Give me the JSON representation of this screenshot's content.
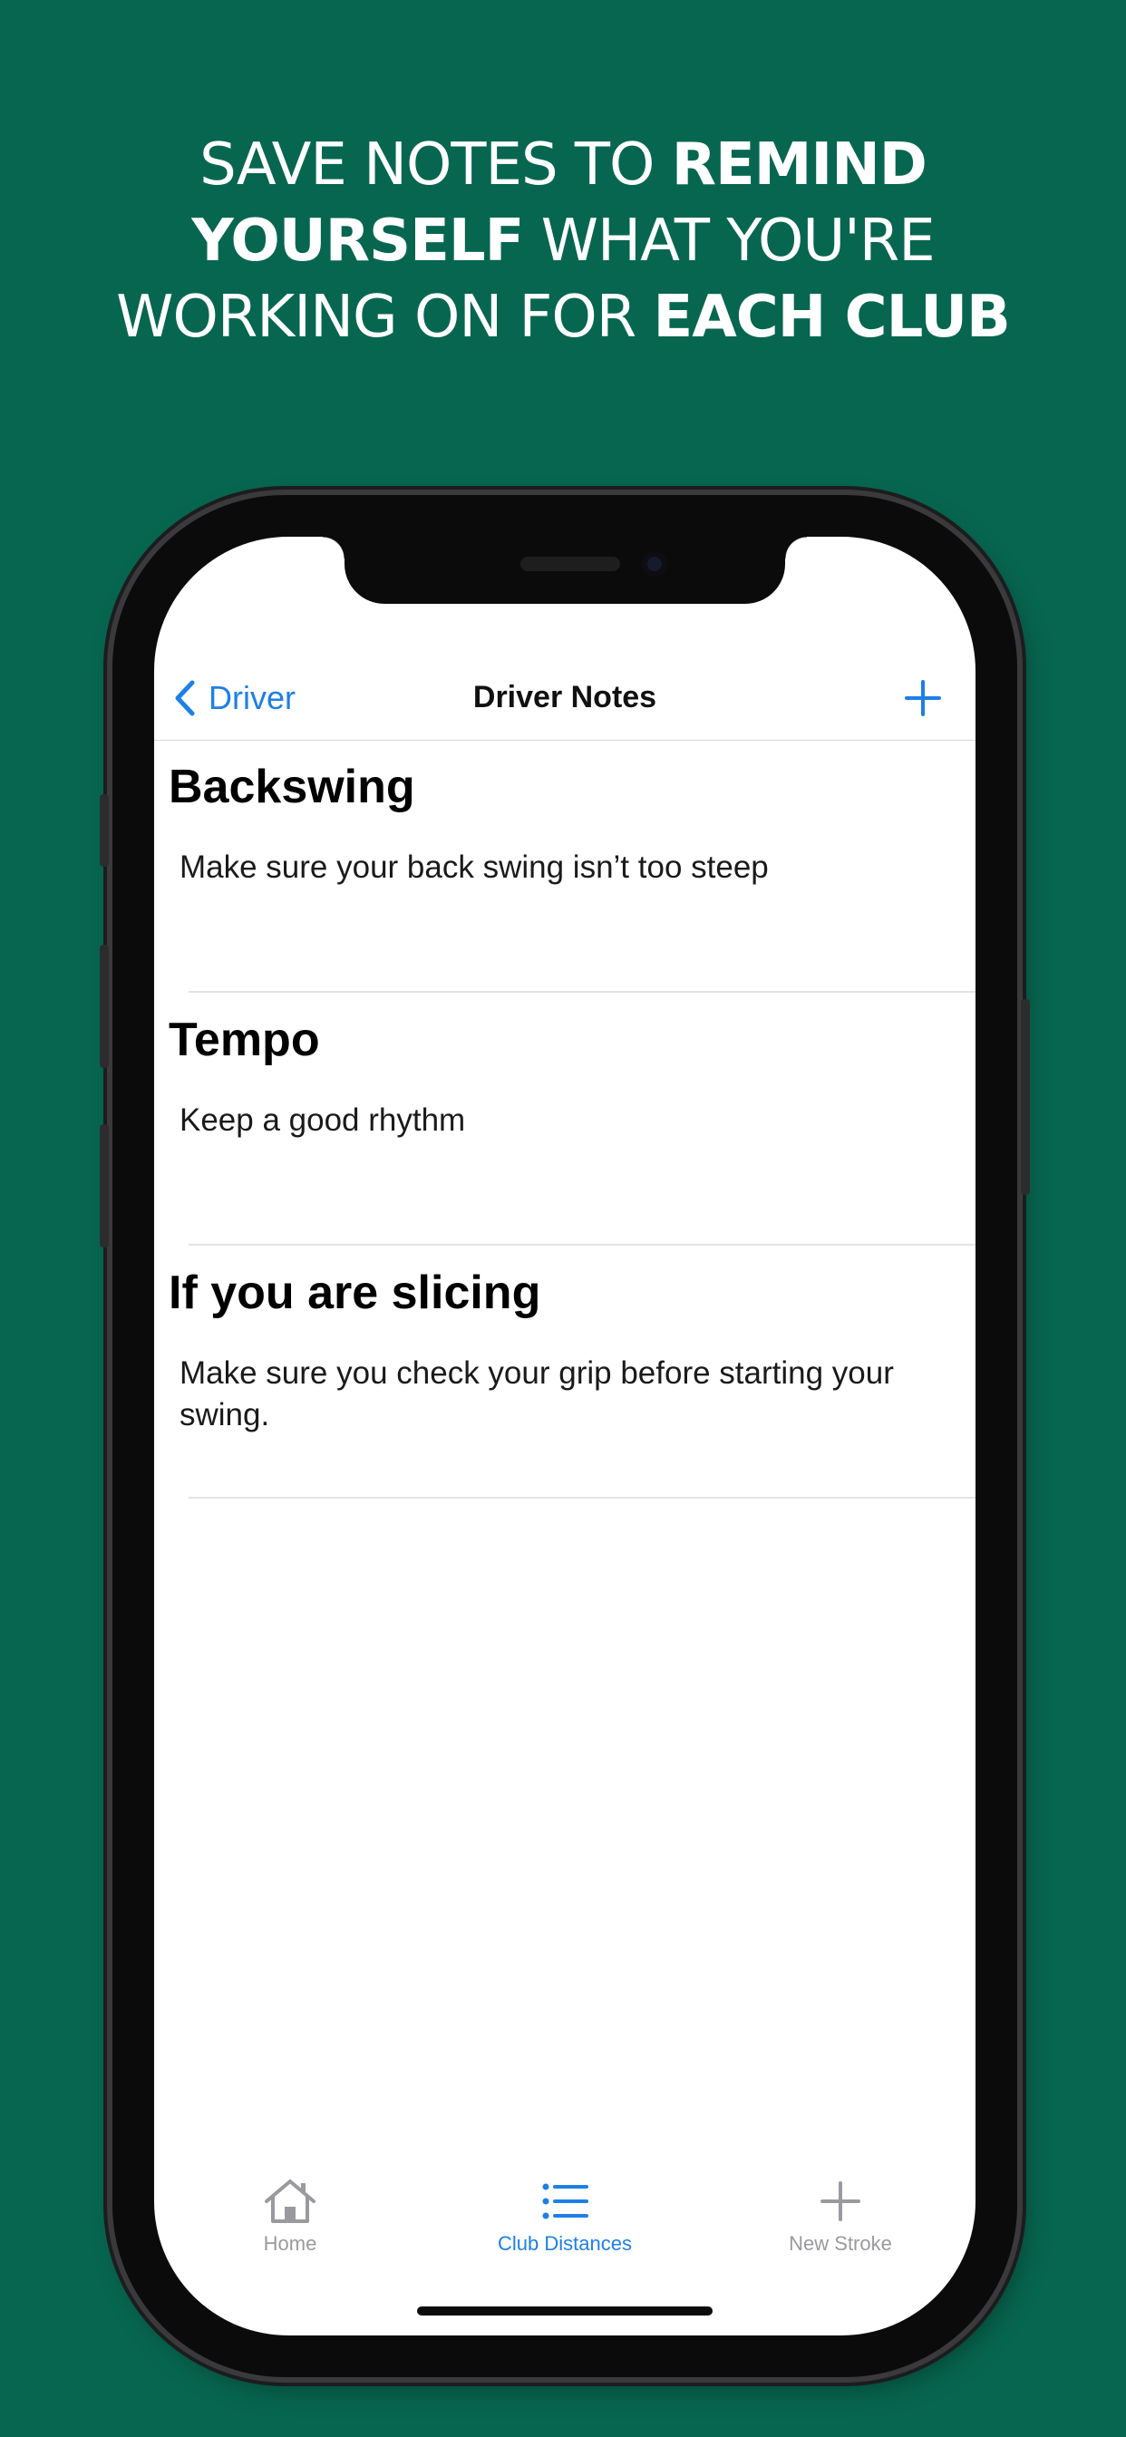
{
  "headline": {
    "line1_regular": "SAVE NOTES TO ",
    "line1_bold": "REMIND",
    "line2_bold": "YOURSELF",
    "line2_regular": " WHAT YOU'RE",
    "line3_regular": "WORKING ON FOR ",
    "line3_bold": "EACH CLUB"
  },
  "navbar": {
    "back_label": "Driver",
    "title": "Driver Notes",
    "add_icon": "plus-icon"
  },
  "notes": [
    {
      "title": "Backswing",
      "body": "Make sure your back swing isn’t too steep"
    },
    {
      "title": "Tempo",
      "body": "Keep a good rhythm"
    },
    {
      "title": "If you are slicing",
      "body": "Make sure you check your grip before starting your swing."
    }
  ],
  "tabbar": {
    "tabs": [
      {
        "label": "Home",
        "icon": "house-icon",
        "active": false
      },
      {
        "label": "Club Distances",
        "icon": "list-icon",
        "active": true
      },
      {
        "label": "New Stroke",
        "icon": "plus-icon",
        "active": false
      }
    ]
  },
  "colors": {
    "background": "#076650",
    "accent": "#1e7fe6",
    "inactive_tab": "#9a9a9e"
  }
}
